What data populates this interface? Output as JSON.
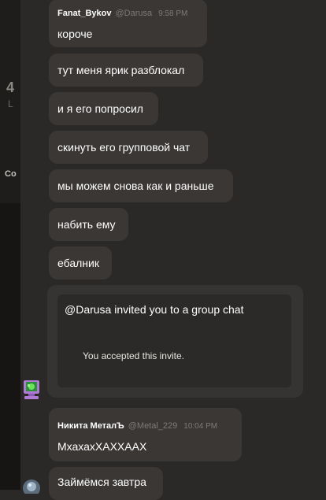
{
  "sidebar": {
    "count_fragment": "4",
    "sub_fragment": "L",
    "section_fragment": "Co"
  },
  "messages": [
    {
      "author": "Fanat_Bykov",
      "handle": "@Darusa",
      "time": "9:58 PM",
      "lines": [
        "короче",
        "тут меня ярик разблокал",
        "и я его попросил",
        "скинуть его групповой чат",
        "мы можем снова как и раньше",
        "набить ему",
        "ебалник"
      ],
      "invite": {
        "title": "@Darusa invited you to a group chat",
        "status": "You accepted this invite."
      }
    },
    {
      "author": "Никита МеталЪ",
      "handle": "@Metal_229",
      "time": "10:04 PM",
      "lines": [
        "МхахахХАХХААХ"
      ]
    },
    {
      "lines": [
        "Займёмся завтра"
      ]
    }
  ],
  "colors": {
    "background": "#2b2927",
    "bubble": "#3a3735",
    "invite_card": "#363432",
    "invite_inner": "#2c2a28",
    "muted_text": "#7d7a76",
    "avatar_green": "#3fbf3f",
    "avatar_purple": "#b07ad6"
  }
}
